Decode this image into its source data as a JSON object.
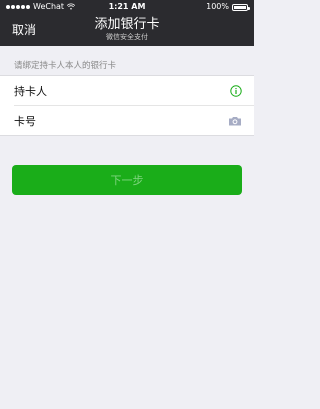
{
  "status_bar": {
    "carrier": "WeChat",
    "time": "1:21 AM",
    "battery": "100%",
    "battery_level": 1.0
  },
  "nav": {
    "back_label": "取消",
    "title": "添加银行卡",
    "subtitle": "微信安全支付"
  },
  "form": {
    "hint": "请绑定持卡人本人的银行卡",
    "cardholder_label": "持卡人",
    "card_number_label": "卡号",
    "info_icon": "info-circle-icon",
    "camera_icon": "camera-icon"
  },
  "buttons": {
    "next_label": "下一步"
  },
  "colors": {
    "nav_bg": "#2b2b2f",
    "page_bg": "#efeff4",
    "accent_green": "#1aad19",
    "icon_gray": "#a6acc4"
  }
}
